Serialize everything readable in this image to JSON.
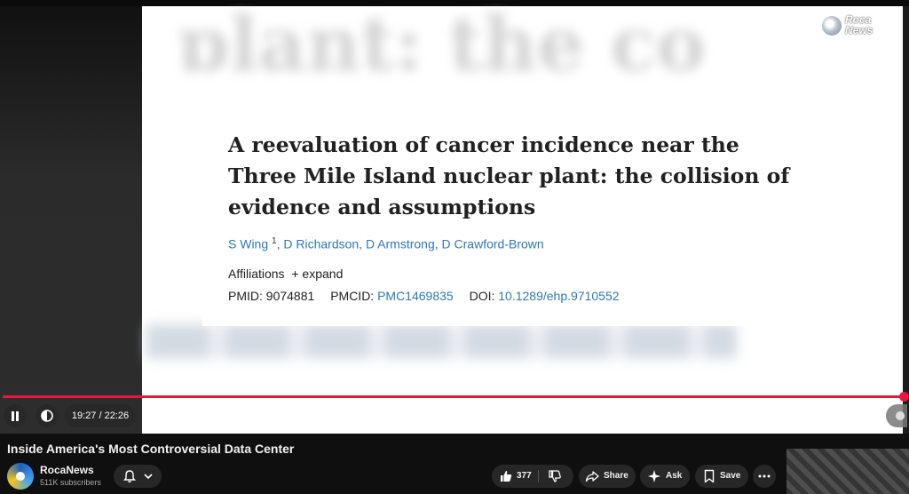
{
  "player": {
    "overlay_logo_text": "Roca\nNews",
    "blurred_top_text": "plant: the co",
    "paper": {
      "title": "A reevaluation of cancer incidence near the Three Mile Island nuclear plant: the collision of evidence and assumptions",
      "authors_first": "S Wing",
      "authors_sup": "1",
      "authors_rest": ", D Richardson, D Armstrong, D Crawford-Brown",
      "affiliations_label": "Affiliations",
      "expand_label": "expand",
      "pmid_label": "PMID:",
      "pmid_value": "9074881",
      "pmcid_label": "PMCID:",
      "pmcid_value": "PMC1469835",
      "doi_label": "DOI:",
      "doi_value": "10.1289/ehp.9710552"
    },
    "controls": {
      "current_time": "19:27",
      "duration": "22:26",
      "time_display": "19:27 / 22:26",
      "progress_fraction": 0.9
    }
  },
  "video": {
    "title": "Inside America's Most Controversial Data Center"
  },
  "channel": {
    "name": "RocaNews",
    "subscribers": "511K subscribers"
  },
  "actions": {
    "like_count": "377",
    "share_label": "Share",
    "ask_label": "Ask",
    "save_label": "Save"
  },
  "colors": {
    "progress": "#e8173f",
    "link": "#2f78b8",
    "pill_bg": "#272727"
  }
}
